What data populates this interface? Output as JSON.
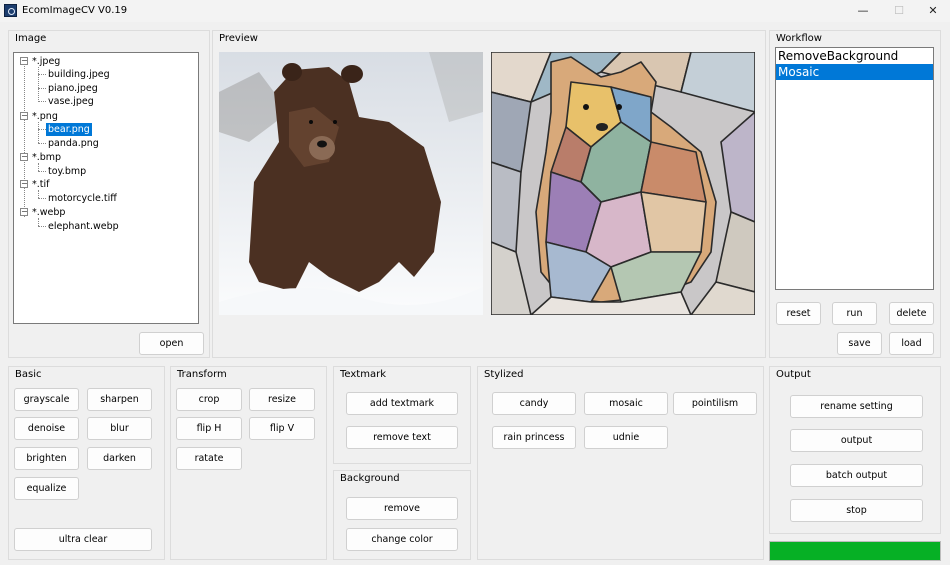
{
  "window": {
    "title": "EcomImageCV  V0.19",
    "min_glyph": "—",
    "max_glyph": "☐",
    "close_glyph": "✕"
  },
  "image_panel": {
    "title": "Image",
    "tree": [
      {
        "label": "*.jpeg",
        "children": [
          "building.jpeg",
          "piano.jpeg",
          "vase.jpeg"
        ]
      },
      {
        "label": "*.png",
        "children": [
          "bear.png",
          "panda.png"
        ]
      },
      {
        "label": "*.bmp",
        "children": [
          "toy.bmp"
        ]
      },
      {
        "label": "*.tif",
        "children": [
          "motorcycle.tiff"
        ]
      },
      {
        "label": "*.webp",
        "children": [
          "elephant.webp"
        ]
      }
    ],
    "selected": "bear.png",
    "expander_glyph": "−",
    "open_label": "open"
  },
  "preview_panel": {
    "title": "Preview"
  },
  "workflow_panel": {
    "title": "Workflow",
    "items": [
      "RemoveBackground",
      "Mosaic"
    ],
    "selected": "Mosaic",
    "reset_label": "reset",
    "run_label": "run",
    "delete_label": "delete",
    "save_label": "save",
    "load_label": "load"
  },
  "basic_panel": {
    "title": "Basic",
    "grayscale": "grayscale",
    "sharpen": "sharpen",
    "denoise": "denoise",
    "blur": "blur",
    "brighten": "brighten",
    "darken": "darken",
    "equalize": "equalize",
    "ultra_clear": "ultra clear"
  },
  "transform_panel": {
    "title": "Transform",
    "crop": "crop",
    "resize": "resize",
    "flip_h": "flip H",
    "flip_v": "flip V",
    "rotate": "ratate"
  },
  "textmark_panel": {
    "title": "Textmark",
    "add_textmark": "add textmark",
    "remove_text": "remove text"
  },
  "background_panel": {
    "title": "Background",
    "remove": "remove",
    "change_color": "change color"
  },
  "stylized_panel": {
    "title": "Stylized",
    "candy": "candy",
    "mosaic": "mosaic",
    "pointilism": "pointilism",
    "rain_princess": "rain princess",
    "udnie": "udnie"
  },
  "output_panel": {
    "title": "Output",
    "rename_setting": "rename setting",
    "output": "output",
    "batch_output": "batch output",
    "stop": "stop",
    "progress": 1.0,
    "progress_color": "#06b025"
  }
}
